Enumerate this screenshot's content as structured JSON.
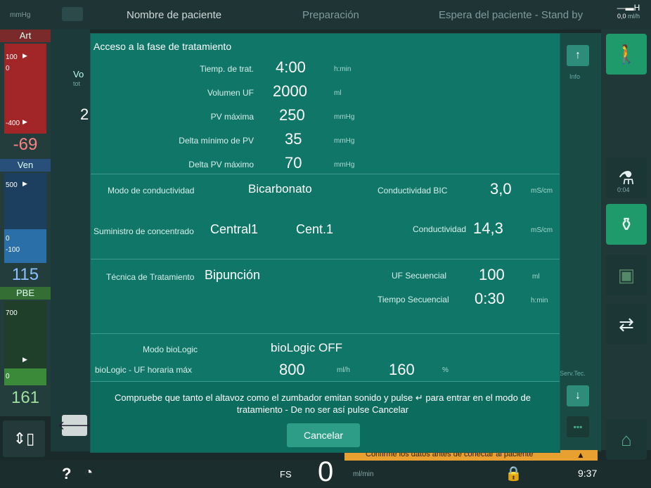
{
  "topbar": {
    "left_unit": "mmHg",
    "patient_name": "Nombre de paciente",
    "phase": "Preparación",
    "status": "Espera del paciente - Stand by",
    "uf_rate_value": "0,0",
    "uf_rate_unit": "ml/h"
  },
  "left": {
    "art": {
      "label": "Art",
      "top": "100",
      "zero": "0",
      "low": "-400",
      "value": "-69"
    },
    "ven": {
      "label": "Ven",
      "top": "500",
      "zero": "0",
      "low": "-100",
      "value": "115"
    },
    "pbe": {
      "label": "PBE",
      "top": "700",
      "zero": "0",
      "value": "161"
    }
  },
  "behind": {
    "vol_label": "Vo",
    "vol_sub": "tot",
    "vol_value": "2"
  },
  "dialog": {
    "title": "Acceso a la fase de tratamiento",
    "params": [
      {
        "label": "Tiemp. de trat.",
        "value": "4:00",
        "unit": "h:min"
      },
      {
        "label": "Volumen UF",
        "value": "2000",
        "unit": "ml"
      },
      {
        "label": "PV máxima",
        "value": "250",
        "unit": "mmHg"
      },
      {
        "label": "Delta mínimo de PV",
        "value": "35",
        "unit": "mmHg"
      },
      {
        "label": "Delta PV máximo",
        "value": "70",
        "unit": "mmHg"
      }
    ],
    "cond_mode_label": "Modo de conductividad",
    "cond_mode_value": "Bicarbonato",
    "bic_label": "Conductividad BIC",
    "bic_value": "3,0",
    "bic_unit": "mS/cm",
    "supply_label": "Suministro de concentrado",
    "supply_value": "Central1",
    "supply_value2": "Cent.1",
    "cond_label": "Conductividad",
    "cond_value": "14,3",
    "cond_unit": "mS/cm",
    "tech_label": "Técnica de Tratamiento",
    "tech_value": "Bipunción",
    "uf_seq_label": "UF Secuencial",
    "uf_seq_value": "100",
    "uf_seq_unit": "ml",
    "time_seq_label": "Tiempo Secuencial",
    "time_seq_value": "0:30",
    "time_seq_unit": "h:min",
    "biologic_label": "Modo bioLogic",
    "biologic_value": "bioLogic OFF",
    "biologic_uf_label": "bioLogic - UF horaria máx",
    "biologic_uf_value": "800",
    "biologic_uf_unit": "ml/h",
    "biologic_pct_value": "160",
    "biologic_pct_unit": "%",
    "message": "Compruebe que tanto el altavoz como el zumbador emitan sonido y pulse ↵ para entrar en el modo de tratamiento - De no ser así pulse Cancelar",
    "cancel_label": "Cancelar"
  },
  "right": {
    "info_label": "Info",
    "timer_label": "0:04",
    "serv_label": "Serv.Tec."
  },
  "notice": "Confirme los datos antes de conectar al paciente",
  "bottombar": {
    "help": "?",
    "fs_label": "FS",
    "fs_value": "0",
    "fs_unit": "ml/min",
    "time": "9:37"
  },
  "colors": {
    "dialog": "#0f7668",
    "accent_green": "#1f9a6a",
    "art_red": "#b0282a",
    "ven_blue": "#2a6fa8",
    "pbe_green": "#3a8a3a",
    "notice_orange": "#e8a030"
  }
}
